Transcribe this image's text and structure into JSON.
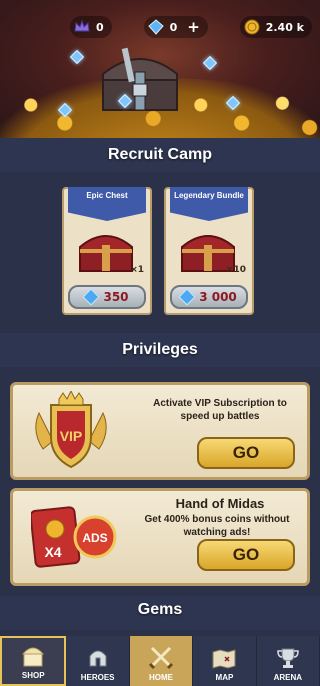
{
  "header": {
    "crowns": "0",
    "gems": "0",
    "coins": "2.40 k",
    "plus": "+"
  },
  "recruit": {
    "title": "Recruit Camp",
    "chests": [
      {
        "name": "Epic Chest",
        "multiplier": "×1",
        "price": "350"
      },
      {
        "name": "Legendary Bundle",
        "multiplier": "×10",
        "price": "3 000"
      }
    ]
  },
  "privileges": {
    "title": "Privileges",
    "vip": {
      "badge": "VIP",
      "text": "Activate VIP Subscription to speed up battles",
      "button": "GO"
    },
    "midas": {
      "title": "Hand of Midas",
      "text": "Get 400% bonus coins without watching ads!",
      "card_x": "X4",
      "card_ads": "ADS",
      "button": "GO"
    }
  },
  "gems_section": {
    "title": "Gems"
  },
  "nav": {
    "items": [
      {
        "label": "SHOP",
        "icon": "shop-icon"
      },
      {
        "label": "HEROES",
        "icon": "helmet-icon"
      },
      {
        "label": "HOME",
        "icon": "crossed-swords-icon"
      },
      {
        "label": "MAP",
        "icon": "map-icon"
      },
      {
        "label": "ARENA",
        "icon": "trophy-icon"
      }
    ]
  },
  "colors": {
    "gold": "#d9a629",
    "accent_blue": "#3f5aa8",
    "price_red": "#8d1a20"
  }
}
